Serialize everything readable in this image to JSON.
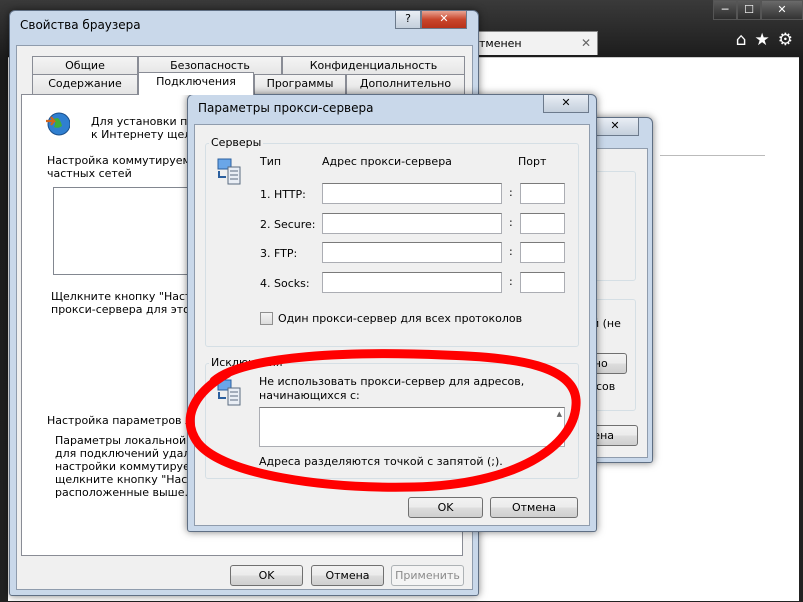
{
  "background": {
    "tab_label": "тменен",
    "tab_close": "✕",
    "window_buttons": {
      "minimize": "─",
      "maximize": "☐",
      "close": "✕"
    },
    "toolbar_icons": [
      "home-icon",
      "star-icon",
      "gear-icon"
    ]
  },
  "props_dialog": {
    "title": "Свойства браузера",
    "help_btn": "?",
    "close_btn": "✕",
    "tabs_row1": [
      "Общие",
      "Безопасность",
      "Конфиденциальность"
    ],
    "tabs_row2": [
      "Содержание",
      "Подключения",
      "Программы",
      "Дополнительно"
    ],
    "active_tab": "Подключения",
    "setup_text_line1": "Для установки под",
    "setup_text_line2": "к Интернету щелкн",
    "dialup_heading_line1": "Настройка коммутируемого",
    "dialup_heading_line2": "частных сетей",
    "dialup_hint_line1": "Щелкните кнопку \"Настро",
    "dialup_hint_line2": "прокси-сервера для этого",
    "lan_heading": "Настройка параметров лока",
    "lan_text": [
      "Параметры локальной сет",
      "для подключений удален",
      "настройки коммутируемо",
      "щелкните кнопку \"Настро",
      "расположенные выше."
    ],
    "ok": "OK",
    "cancel": "Отмена",
    "apply": "Применить"
  },
  "mid_dialog": {
    "text1": "й (не",
    "btn1": "льно",
    "text2": "сов",
    "btn2": "мена"
  },
  "proxy_dialog": {
    "title": "Параметры прокси-сервера",
    "close_btn": "✕",
    "servers_group": "Серверы",
    "col_type": "Тип",
    "col_address": "Адрес прокси-сервера",
    "col_port": "Порт",
    "rows": [
      {
        "label": "1. HTTP:",
        "address": "",
        "port": ""
      },
      {
        "label": "2. Secure:",
        "address": "",
        "port": ""
      },
      {
        "label": "3. FTP:",
        "address": "",
        "port": ""
      },
      {
        "label": "4. Socks:",
        "address": "",
        "port": ""
      }
    ],
    "colon": ":",
    "same_proxy_checkbox": "Один прокси-сервер для всех протоколов",
    "same_proxy_checked": false,
    "exceptions_group": "Исключения",
    "exceptions_label_line1": "Не использовать прокси-сервер для адресов,",
    "exceptions_label_line2": "начинающихся с:",
    "exceptions_value": "",
    "exceptions_hint": "Адреса разделяются точкой с запятой (;).",
    "ok": "OK",
    "cancel": "Отмена"
  },
  "annotation": {
    "color": "#ff0000"
  }
}
